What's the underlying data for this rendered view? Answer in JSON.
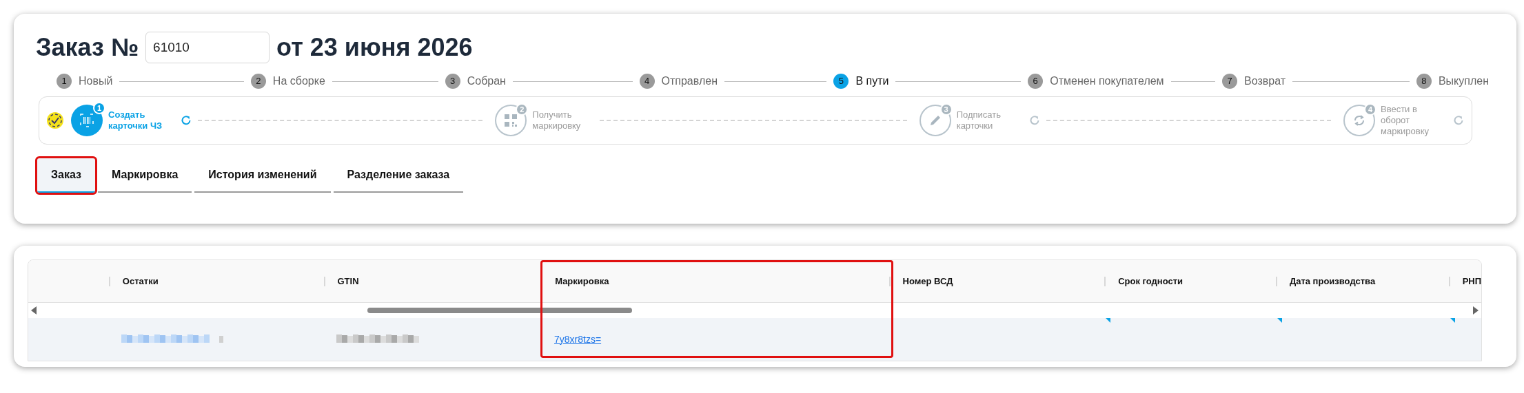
{
  "order": {
    "title_prefix": "Заказ №",
    "number": "61010",
    "title_suffix": "от 23 июня 2026"
  },
  "statuses": [
    {
      "number": "1",
      "label": "Новый",
      "selected": false
    },
    {
      "number": "2",
      "label": "На сборке",
      "selected": false
    },
    {
      "number": "3",
      "label": "Собран",
      "selected": false
    },
    {
      "number": "4",
      "label": "Отправлен",
      "selected": false
    },
    {
      "number": "5",
      "label": "В пути",
      "selected": true
    },
    {
      "number": "6",
      "label": "Отменен покупателем",
      "selected": false
    },
    {
      "number": "7",
      "label": "Возврат",
      "selected": false
    },
    {
      "number": "8",
      "label": "Выкуплен",
      "selected": false
    }
  ],
  "marking_steps": [
    {
      "number": "1",
      "label": "Создать карточки ЧЗ",
      "kind": "barcode",
      "active": true,
      "refresh": true
    },
    {
      "number": "2",
      "label": "Получить маркировку",
      "kind": "qr",
      "active": false,
      "refresh": false
    },
    {
      "number": "3",
      "label": "Подписать карточки",
      "kind": "pen",
      "active": false,
      "refresh": true
    },
    {
      "number": "4",
      "label": "Ввести в оборот маркировку",
      "kind": "cycle",
      "active": false,
      "refresh": true
    }
  ],
  "tabs": [
    {
      "label": "Заказ",
      "selected": true,
      "highlighted": true
    },
    {
      "label": "Маркировка",
      "selected": false,
      "highlighted": false
    },
    {
      "label": "История изменений",
      "selected": false,
      "highlighted": false
    },
    {
      "label": "Разделение заказа",
      "selected": false,
      "highlighted": false
    }
  ],
  "table": {
    "columns": [
      {
        "label": "Остатки",
        "highlighted": false
      },
      {
        "label": "GTIN",
        "highlighted": false
      },
      {
        "label": "Маркировка",
        "highlighted": true
      },
      {
        "label": "Номер ВСД",
        "highlighted": false
      },
      {
        "label": "Срок годности",
        "highlighted": false
      },
      {
        "label": "Дата производства",
        "highlighted": false
      },
      {
        "label": "РНП",
        "highlighted": false
      }
    ],
    "rows": [
      {
        "cells": [
          {
            "kind": "blurred_link",
            "flagged": false
          },
          {
            "kind": "blurred",
            "flagged": false
          },
          {
            "kind": "link",
            "text": "7y8xr8tzs=",
            "flagged": false
          },
          {
            "kind": "empty",
            "flagged": false
          },
          {
            "kind": "empty",
            "flagged": true
          },
          {
            "kind": "empty",
            "flagged": true
          },
          {
            "kind": "empty",
            "flagged": true
          }
        ]
      }
    ]
  }
}
